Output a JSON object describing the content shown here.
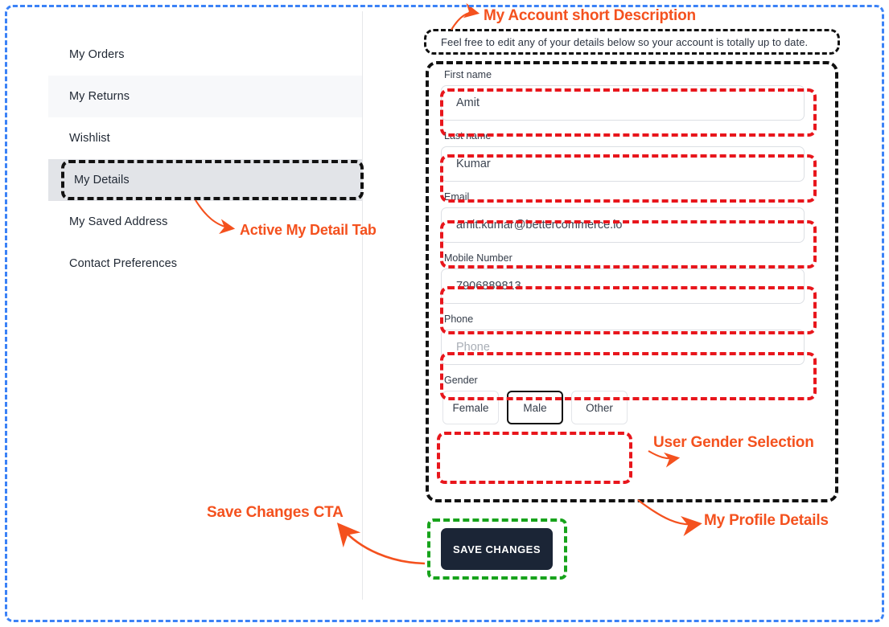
{
  "page": {
    "description": "Feel free to edit any of your details below so your account is totally up to date."
  },
  "sidebar": {
    "items": [
      {
        "label": "My Orders",
        "state": "default"
      },
      {
        "label": "My Returns",
        "state": "hovered"
      },
      {
        "label": "Wishlist",
        "state": "default"
      },
      {
        "label": "My Details",
        "state": "active"
      },
      {
        "label": "My Saved Address",
        "state": "default"
      },
      {
        "label": "Contact Preferences",
        "state": "default"
      }
    ]
  },
  "form": {
    "fields": [
      {
        "label": "First name",
        "value": "Amit",
        "placeholder": "First name",
        "is_placeholder": false
      },
      {
        "label": "Last name",
        "value": "Kumar",
        "placeholder": "Last name",
        "is_placeholder": false
      },
      {
        "label": "Email",
        "value": "amit.kumar@bettercommerce.io",
        "placeholder": "Email",
        "is_placeholder": false
      },
      {
        "label": "Mobile Number",
        "value": "7906889813",
        "placeholder": "Mobile Number",
        "is_placeholder": false
      },
      {
        "label": "Phone",
        "value": "Phone",
        "placeholder": "Phone",
        "is_placeholder": true
      }
    ],
    "gender": {
      "label": "Gender",
      "options": [
        "Female",
        "Male",
        "Other"
      ],
      "selected": "Male"
    },
    "save_label": "SAVE CHANGES"
  },
  "annotations": {
    "account_description": "My Account short Description",
    "active_tab": "Active My Detail Tab",
    "gender_selection": "User Gender Selection",
    "save_cta": "Save Changes CTA",
    "profile_details": "My Profile Details"
  },
  "colors": {
    "callout": "#f4511e",
    "outer_frame": "#3b82f6",
    "field_highlight": "#e8161c",
    "group_highlight": "#111111",
    "save_highlight": "#17a31b",
    "save_button_bg": "#1b2536"
  }
}
